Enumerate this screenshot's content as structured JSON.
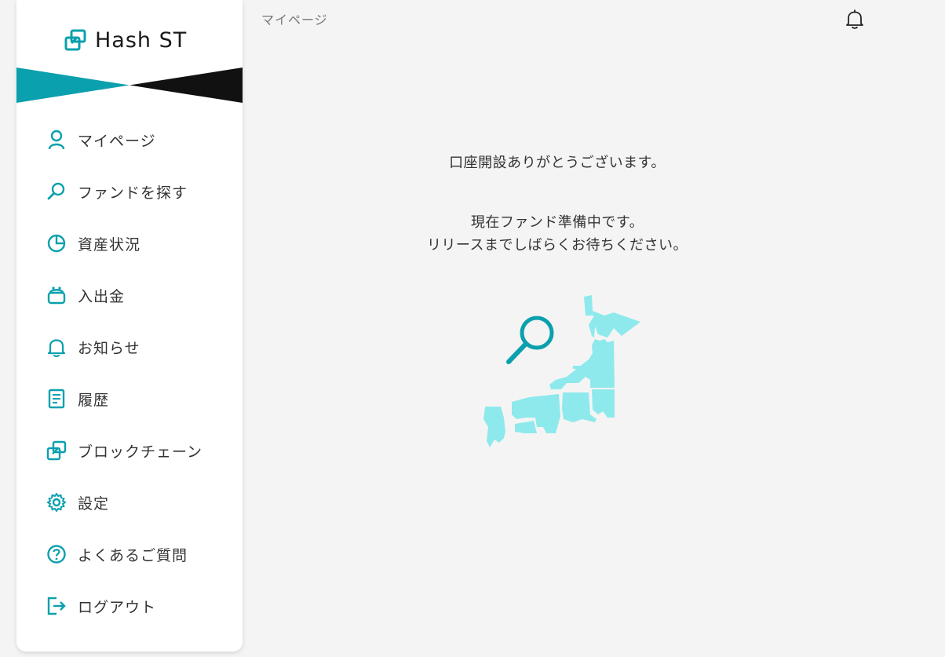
{
  "brand": {
    "name": "Hash ST"
  },
  "colors": {
    "accent": "#0aa0ad",
    "map": "#8ee9ec",
    "banner_dark": "#111111"
  },
  "sidebar": {
    "items": [
      {
        "label": "マイページ",
        "icon": "user-icon"
      },
      {
        "label": "ファンドを探す",
        "icon": "search-icon"
      },
      {
        "label": "資産状況",
        "icon": "pie-chart-icon"
      },
      {
        "label": "入出金",
        "icon": "wallet-icon"
      },
      {
        "label": "お知らせ",
        "icon": "bell-icon"
      },
      {
        "label": "履歴",
        "icon": "document-icon"
      },
      {
        "label": "ブロックチェーン",
        "icon": "blockchain-icon"
      },
      {
        "label": "設定",
        "icon": "gear-icon"
      },
      {
        "label": "よくあるご質問",
        "icon": "question-icon"
      },
      {
        "label": "ログアウト",
        "icon": "logout-icon"
      }
    ]
  },
  "header": {
    "breadcrumb": "マイページ",
    "notification_icon": "bell-icon"
  },
  "main": {
    "message_1": "口座開設ありがとうございます。",
    "message_2_line1": "現在ファンド準備中です。",
    "message_2_line2": "リリースまでしばらくお待ちください。",
    "illustration": "japan-map-search-illustration"
  }
}
